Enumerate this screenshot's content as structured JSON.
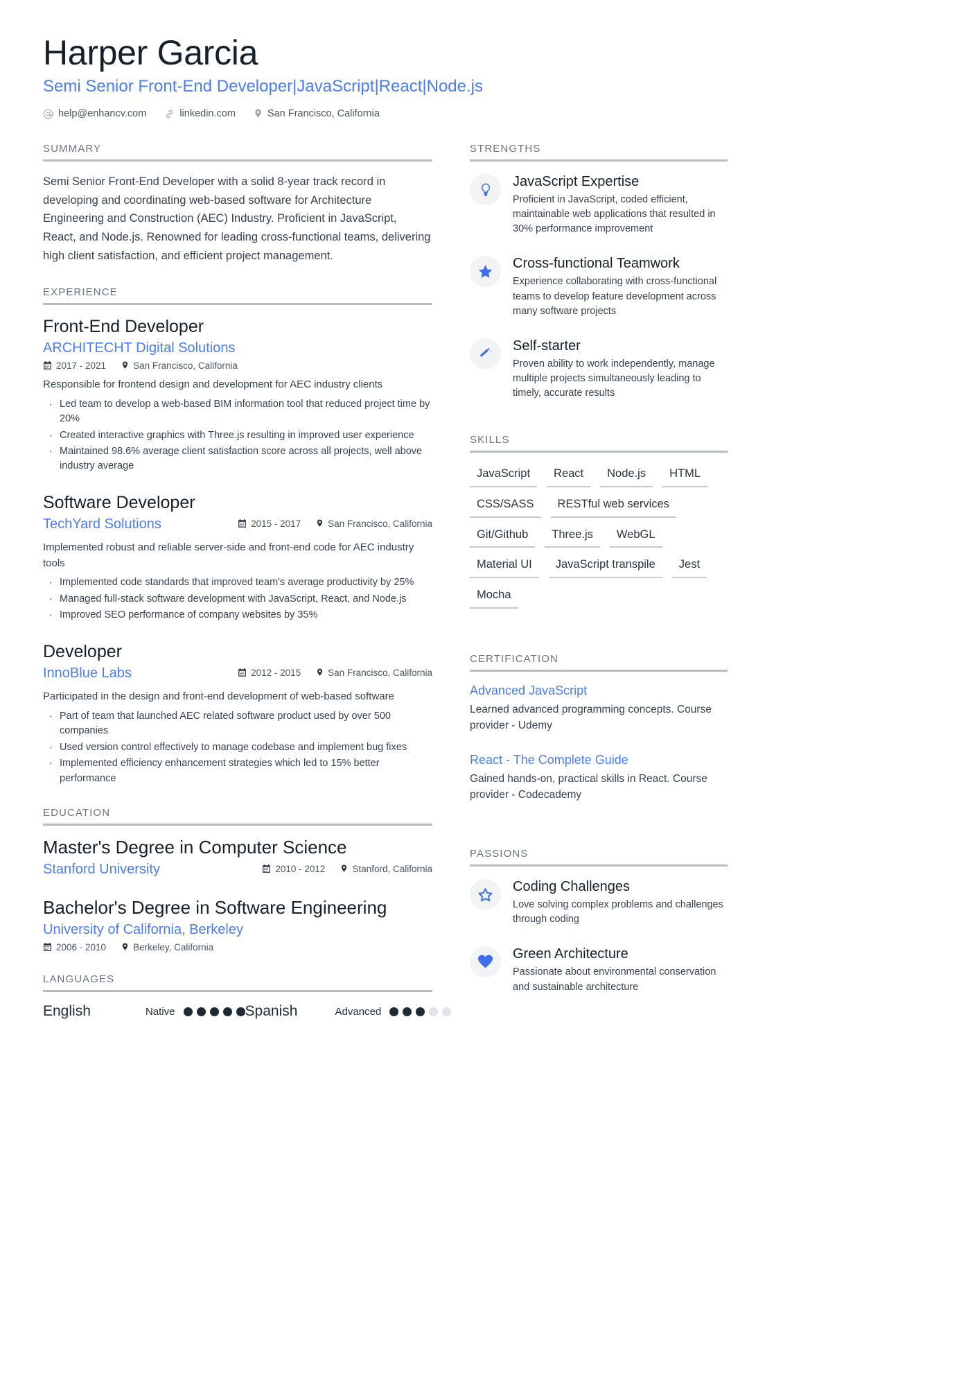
{
  "colors": {
    "accent": "#4a7cf3",
    "heading": "#16202d",
    "body": "#374151",
    "muted": "#6b7280",
    "rule": "#b8bcc2",
    "badge_bg": "#f2f3f4",
    "dot_on": "#1f2a37",
    "dot_off": "#e2e4e7"
  },
  "header": {
    "name": "Harper Garcia",
    "headline": "Semi Senior Front-End Developer|JavaScript|React|Node.js",
    "contacts": [
      {
        "icon": "at-icon",
        "text": "help@enhancv.com"
      },
      {
        "icon": "link-icon",
        "text": "linkedin.com"
      },
      {
        "icon": "location-pin-icon",
        "text": "San Francisco, California"
      }
    ]
  },
  "sections": {
    "summary": {
      "title": "SUMMARY",
      "text": "Semi Senior Front-End Developer with a solid 8-year track record in developing and coordinating web-based software for Architecture Engineering and Construction (AEC) Industry. Proficient in JavaScript, React, and Node.js. Renowned for leading cross-functional teams, delivering high client satisfaction, and efficient project management."
    },
    "experience": {
      "title": "EXPERIENCE",
      "entries": [
        {
          "role": "Front-End Developer",
          "company": "ARCHITECHT Digital Solutions",
          "dates": "2017 - 2021",
          "location": "San Francisco, California",
          "meta_inline": false,
          "description": "Responsible for frontend design and development for AEC industry clients",
          "bullets": [
            "Led team to develop a web-based BIM information tool that reduced project time by 20%",
            "Created interactive graphics with Three.js resulting in improved user experience",
            "Maintained 98.6% average client satisfaction score across all projects, well above industry average"
          ]
        },
        {
          "role": "Software Developer",
          "company": "TechYard Solutions",
          "dates": "2015 - 2017",
          "location": "San Francisco, California",
          "meta_inline": true,
          "description": "Implemented robust and reliable server-side and front-end code for AEC industry tools",
          "bullets": [
            "Implemented code standards that improved team's average productivity by 25%",
            "Managed full-stack software development with JavaScript, React, and Node.js",
            "Improved SEO performance of company websites by 35%"
          ]
        },
        {
          "role": "Developer",
          "company": "InnoBlue Labs",
          "dates": "2012 - 2015",
          "location": "San Francisco, California",
          "meta_inline": true,
          "description": "Participated in the design and front-end development of web-based software",
          "bullets": [
            "Part of team that launched AEC related software product used by over 500 companies",
            "Used version control effectively to manage codebase and implement bug fixes",
            "Implemented efficiency enhancement strategies which led to 15% better performance"
          ]
        }
      ]
    },
    "education": {
      "title": "EDUCATION",
      "entries": [
        {
          "degree": "Master's Degree in Computer Science",
          "school": "Stanford University",
          "dates": "2010 - 2012",
          "location": "Stanford, California",
          "meta_inline": true
        },
        {
          "degree": "Bachelor's Degree in Software Engineering",
          "school": "University of California, Berkeley",
          "dates": "2006 - 2010",
          "location": "Berkeley, California",
          "meta_inline": false
        }
      ]
    },
    "languages": {
      "title": "LANGUAGES",
      "items": [
        {
          "name": "English",
          "level": "Native",
          "filled": 5,
          "total": 5
        },
        {
          "name": "Spanish",
          "level": "Advanced",
          "filled": 3,
          "total": 5
        }
      ]
    },
    "strengths": {
      "title": "STRENGTHS",
      "items": [
        {
          "icon": "lightbulb-icon",
          "title": "JavaScript Expertise",
          "desc": "Proficient in JavaScript, coded efficient, maintainable web applications that resulted in 30% performance improvement"
        },
        {
          "icon": "star-filled-icon",
          "title": "Cross-functional Teamwork",
          "desc": "Experience collaborating with cross-functional teams to develop feature development across many software projects"
        },
        {
          "icon": "magic-wand-icon",
          "title": "Self-starter",
          "desc": "Proven ability to work independently, manage multiple projects simultaneously leading to timely, accurate results"
        }
      ]
    },
    "skills": {
      "title": "SKILLS",
      "tags": [
        "JavaScript",
        "React",
        "Node.js",
        "HTML",
        "CSS/SASS",
        "RESTful web services",
        "Git/Github",
        "Three.js",
        "WebGL",
        "Material UI",
        "JavaScript transpile",
        "Jest",
        "Mocha"
      ]
    },
    "certification": {
      "title": "CERTIFICATION",
      "items": [
        {
          "title": "Advanced JavaScript",
          "desc": "Learned advanced programming concepts. Course provider - Udemy"
        },
        {
          "title": "React - The Complete Guide",
          "desc": "Gained hands-on, practical skills in React. Course provider - Codecademy"
        }
      ]
    },
    "passions": {
      "title": "PASSIONS",
      "items": [
        {
          "icon": "star-outline-icon",
          "title": "Coding Challenges",
          "desc": "Love solving complex problems and challenges through coding"
        },
        {
          "icon": "heart-icon",
          "title": "Green Architecture",
          "desc": "Passionate about environmental conservation and sustainable architecture"
        }
      ]
    }
  }
}
